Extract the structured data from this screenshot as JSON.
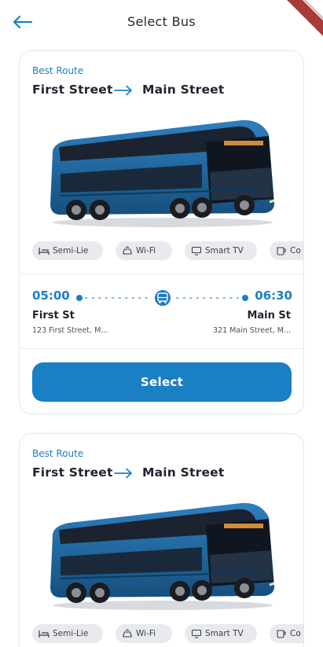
{
  "header": {
    "title": "Select Bus",
    "back_icon": "arrow-left-icon"
  },
  "colors": {
    "accent": "#1a7fc4",
    "chip_bg": "#e9eaee",
    "text": "#1f2430"
  },
  "cards": [
    {
      "tag": "Best Route",
      "from": "First Street",
      "to": "Main Street",
      "amenities": [
        {
          "icon": "bed-icon",
          "label": "Semi-Lie"
        },
        {
          "icon": "wifi-car-icon",
          "label": "Wi-Fi"
        },
        {
          "icon": "tv-icon",
          "label": "Smart TV"
        },
        {
          "icon": "coffee-icon",
          "label": "Co"
        }
      ],
      "departure_time": "05:00",
      "arrival_time": "06:30",
      "from_stop": "First St",
      "to_stop": "Main St",
      "from_address": "123 First Street, M...",
      "to_address": "321 Main Street, M...",
      "select_label": "Select"
    },
    {
      "tag": "Best Route",
      "from": "First Street",
      "to": "Main Street",
      "amenities": [
        {
          "icon": "bed-icon",
          "label": "Semi-Lie"
        },
        {
          "icon": "wifi-car-icon",
          "label": "Wi-Fi"
        },
        {
          "icon": "tv-icon",
          "label": "Smart TV"
        },
        {
          "icon": "coffee-icon",
          "label": "Co"
        }
      ]
    }
  ]
}
